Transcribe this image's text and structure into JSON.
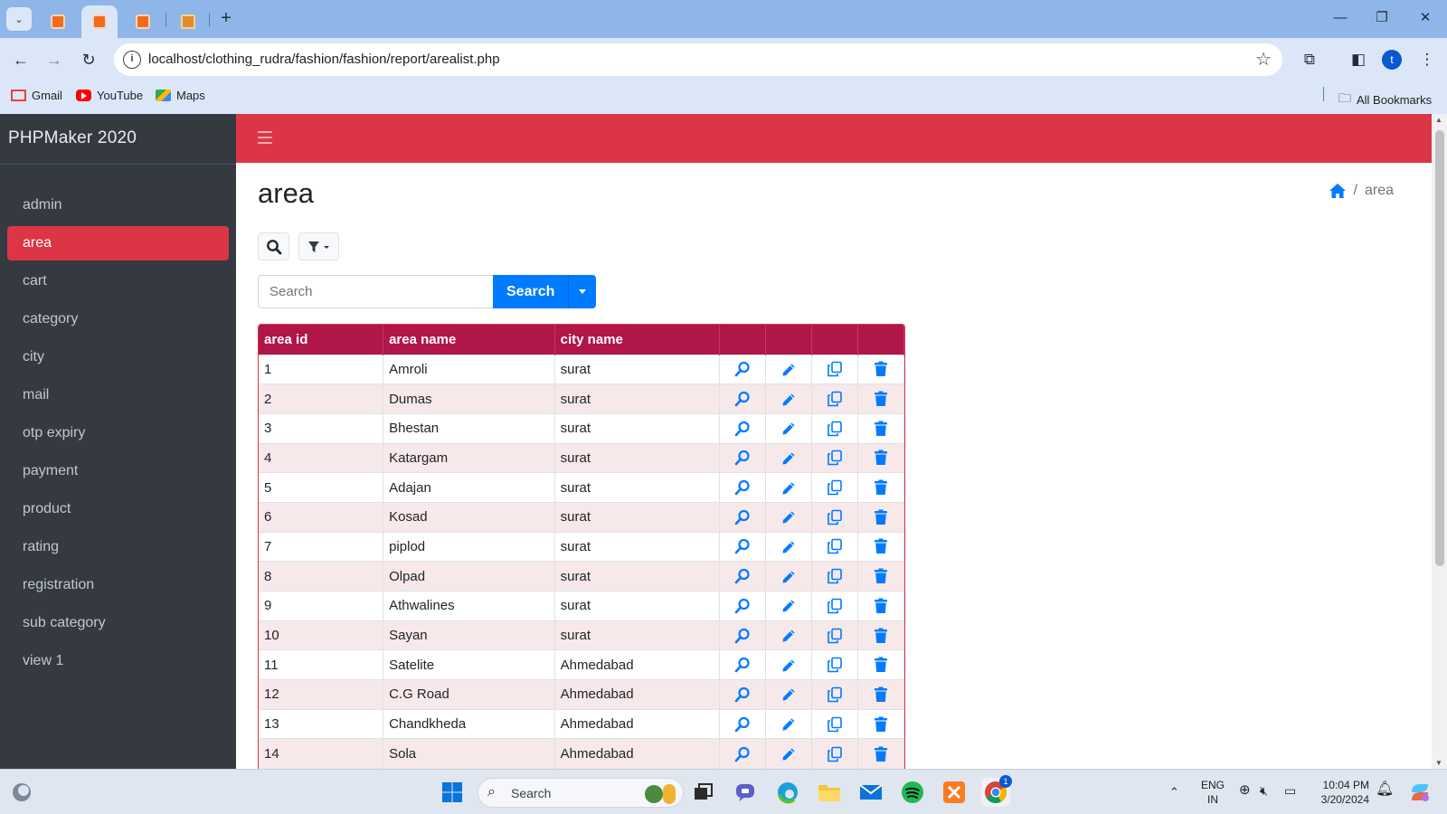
{
  "browser": {
    "url": "localhost/clothing_rudra/fashion/fashion/report/arealist.php",
    "avatar_letter": "t",
    "bookmarks": [
      {
        "label": "Gmail",
        "icon": "gmail-icon"
      },
      {
        "label": "YouTube",
        "icon": "youtube-icon"
      },
      {
        "label": "Maps",
        "icon": "maps-icon"
      }
    ],
    "all_bookmarks_label": "All Bookmarks"
  },
  "app": {
    "brand": "PHPMaker 2020",
    "accent_color": "#dc3545",
    "header_color": "#b0164a",
    "sidebar_items": [
      {
        "label": "admin",
        "active": false
      },
      {
        "label": "area",
        "active": true
      },
      {
        "label": "cart",
        "active": false
      },
      {
        "label": "category",
        "active": false
      },
      {
        "label": "city",
        "active": false
      },
      {
        "label": "mail",
        "active": false
      },
      {
        "label": "otp expiry",
        "active": false
      },
      {
        "label": "payment",
        "active": false
      },
      {
        "label": "product",
        "active": false
      },
      {
        "label": "rating",
        "active": false
      },
      {
        "label": "registration",
        "active": false
      },
      {
        "label": "sub category",
        "active": false
      },
      {
        "label": "view 1",
        "active": false
      }
    ]
  },
  "page": {
    "title": "area",
    "breadcrumb_current": "area",
    "search_placeholder": "Search",
    "search_button": "Search"
  },
  "table": {
    "columns": [
      "area id",
      "area name",
      "city name"
    ],
    "row_actions": [
      "view-icon",
      "edit-icon",
      "copy-icon",
      "delete-icon"
    ],
    "rows": [
      [
        "1",
        "Amroli",
        "surat"
      ],
      [
        "2",
        "Dumas",
        "surat"
      ],
      [
        "3",
        "Bhestan",
        "surat"
      ],
      [
        "4",
        "Katargam",
        "surat"
      ],
      [
        "5",
        "Adajan",
        "surat"
      ],
      [
        "6",
        "Kosad",
        "surat"
      ],
      [
        "7",
        "piplod",
        "surat"
      ],
      [
        "8",
        "Olpad",
        "surat"
      ],
      [
        "9",
        "Athwalines",
        "surat"
      ],
      [
        "10",
        "Sayan",
        "surat"
      ],
      [
        "11",
        "Satelite",
        "Ahmedabad"
      ],
      [
        "12",
        "C.G Road",
        "Ahmedabad"
      ],
      [
        "13",
        "Chandkheda",
        "Ahmedabad"
      ],
      [
        "14",
        "Sola",
        "Ahmedabad"
      ]
    ]
  },
  "taskbar": {
    "search_label": "Search",
    "lang_top": "ENG",
    "lang_bottom": "IN",
    "time": "10:04 PM",
    "date": "3/20/2024",
    "chrome_badge": "1"
  }
}
